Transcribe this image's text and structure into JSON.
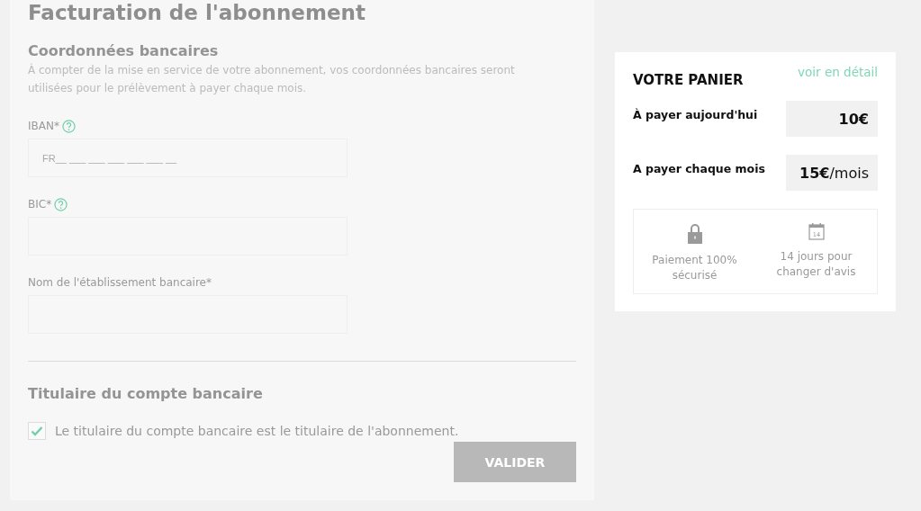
{
  "title": "Facturation de l'abonnement",
  "bank_section": {
    "heading": "Coordonnées bancaires",
    "description": "À compter de la mise en service de votre abonnement, vos coordonnées bancaires seront utilisées pour le prélèvement à payer chaque mois."
  },
  "fields": [
    {
      "label": "IBAN*",
      "help": true,
      "placeholder": "FR__ ___ ___ ___ ___ ___ __"
    },
    {
      "label": "BIC*",
      "help": true
    },
    {
      "label": "Nom de l'établissement bancaire*",
      "help": false
    }
  ],
  "holder_section": {
    "heading": "Titulaire du compte bancaire",
    "checkbox": {
      "label": "Le titulaire du compte bancaire est le titulaire de l'abonnement.",
      "checked": true
    }
  },
  "submit": {
    "label": "VALIDER",
    "disabled": true
  },
  "cart": {
    "title": "VOTRE PANIER",
    "detail_link": "voir en détail",
    "lines": [
      {
        "label": "À payer aujourd'hui",
        "amount": "**10€**"
      },
      {
        "label": "A payer chaque mois",
        "amount": "**15€**/mois"
      }
    ],
    "assurances": [
      {
        "kind": "lock",
        "text": "Paiement 100% sécurisé"
      },
      {
        "kind": "calendar",
        "badge": "14",
        "text": "14 jours pour changer d'avis"
      }
    ]
  }
}
